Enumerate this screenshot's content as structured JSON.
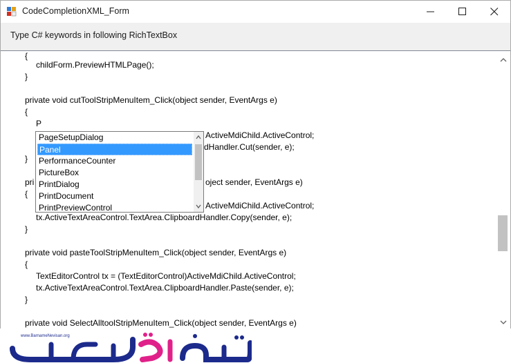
{
  "window": {
    "title": "CodeCompletionXML_Form"
  },
  "header": {
    "prompt": "Type C# keywords in following RichTextBox"
  },
  "editor": {
    "lines": [
      "{",
      "childForm.PreviewHTMLPage();",
      "}",
      "private void cutToolStripMenuItem_Click(object sender, EventArgs e)",
      "{",
      "P",
      "ActiveMdiChild.ActiveControl;",
      "rdHandler.Cut(sender, e);",
      "}",
      "pri",
      "oject sender, EventArgs e)",
      "{",
      "ActiveMdiChild.ActiveControl;",
      "tx.ActiveTextAreaControl.TextArea.ClipboardHandler.Copy(sender, e);",
      "}",
      "private void pasteToolStripMenuItem_Click(object sender, EventArgs e)",
      "{",
      "TextEditorControl tx = (TextEditorControl)ActiveMdiChild.ActiveControl;",
      "tx.ActiveTextAreaControl.TextArea.ClipboardHandler.Paste(sender, e);",
      "}",
      "private void SelectAlltoolStripMenuItem_Click(object sender, EventArgs e)"
    ]
  },
  "completion": {
    "items": [
      "PageSetupDialog",
      "Panel",
      "PerformanceCounter",
      "PictureBox",
      "PrintDialog",
      "PrintDocument",
      "PrintPreviewControl"
    ],
    "selected_index": 1
  },
  "logo": {
    "site_url": "www.BarnameNevisan.org",
    "text": "برنامه نویسان"
  },
  "colors": {
    "selection": "#3399ff",
    "logo_blue": "#1c2a8c",
    "logo_pink": "#e0218a"
  }
}
